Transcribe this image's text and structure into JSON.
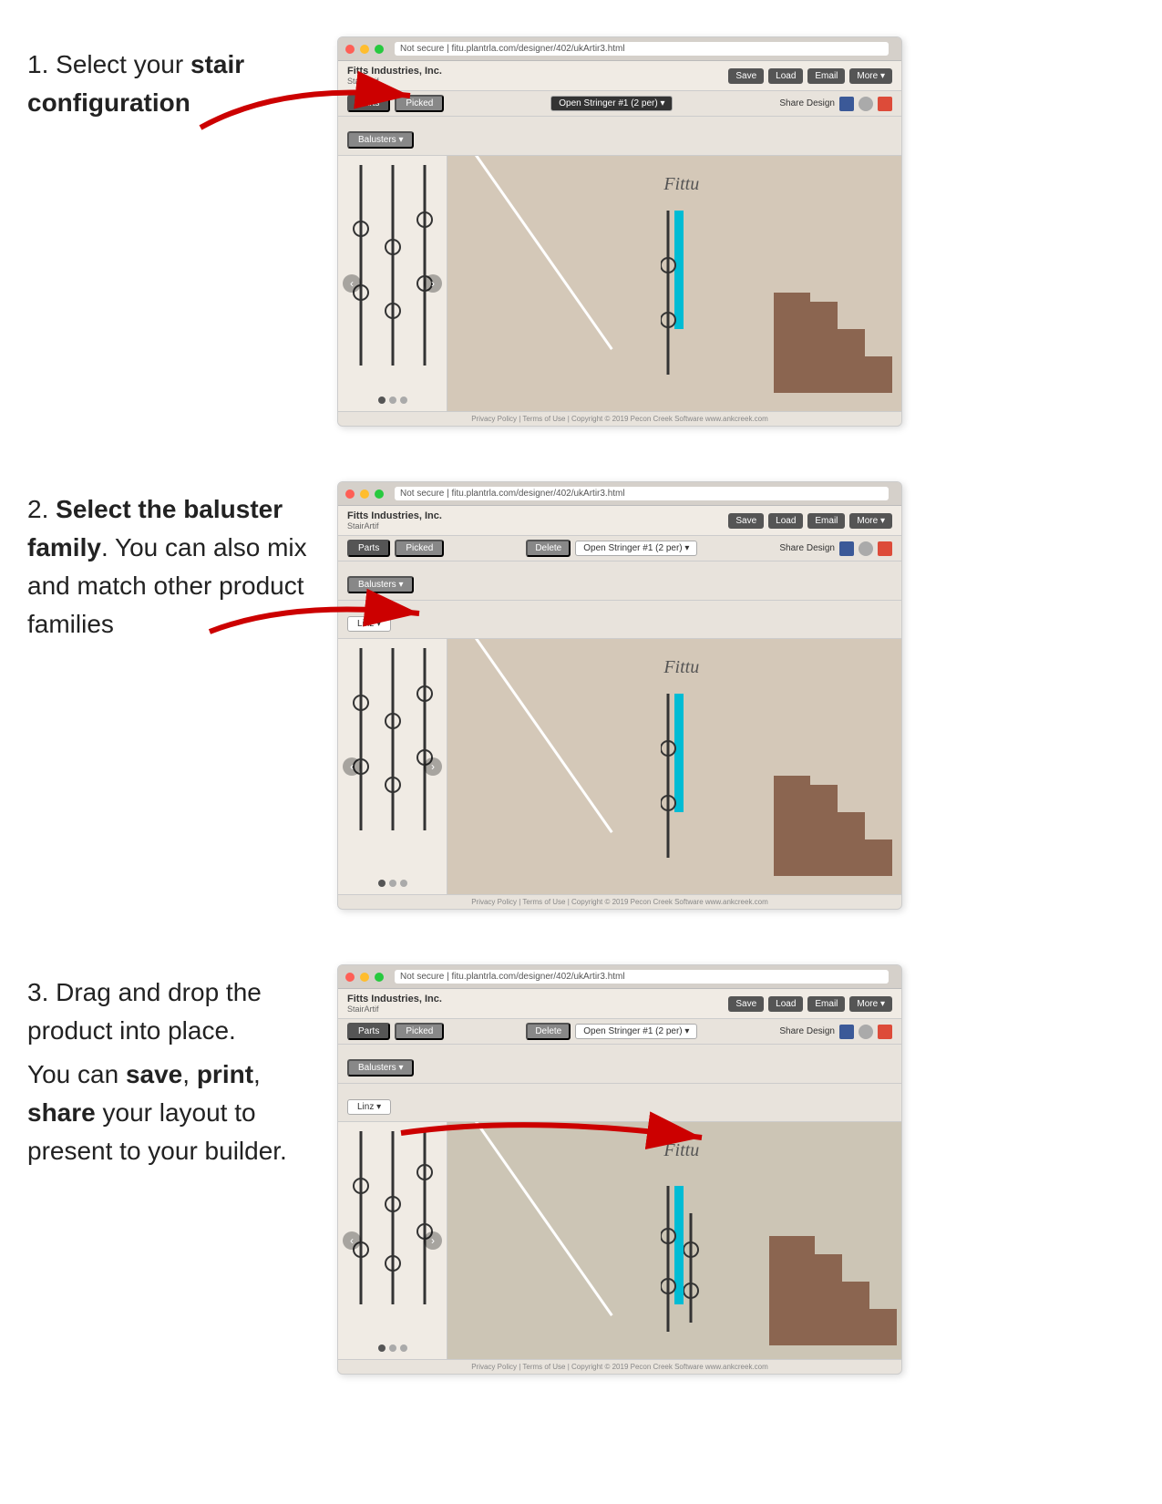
{
  "page": {
    "background": "#ffffff"
  },
  "steps": [
    {
      "number": "1.",
      "text_before": "Select your ",
      "bold_text": "stair configuration",
      "text_after": "",
      "show_delete": false,
      "show_linz": false
    },
    {
      "number": "2.",
      "text_line1_before": "",
      "text_line1_bold": "Select the baluster family",
      "text_line2": "You can also mix and match other product families",
      "show_delete": true,
      "show_linz": true
    },
    {
      "number": "3.",
      "lines": [
        {
          "before": "Drag and drop the product into place.",
          "bold": ""
        },
        {
          "before": "You can ",
          "bold": "save"
        },
        {
          "before": ", ",
          "bold": "print"
        },
        {
          "before": ", ",
          "bold": "share"
        },
        {
          "before": " your layout to present to your builder.",
          "bold": ""
        }
      ],
      "show_delete": true,
      "show_linz": true
    }
  ],
  "browser": {
    "url": "Not secure | fitu.plantrla.com/designer/402/ukArtir3.html",
    "logo": "Fitts Industries, Inc.",
    "logo_sub": "StairArtif",
    "btn_save": "Save",
    "btn_load": "Load",
    "btn_email": "Email",
    "btn_more": "More ▾",
    "tab_parts": "Parts",
    "tab_picked": "Picked",
    "dropdown_stringer": "Open Stringer #1 (2 per) ▾",
    "btn_delete": "Delete",
    "share_label": "Share Design",
    "section_balusters": "Balusters ▾",
    "family_linz": "Linz ▾",
    "footer_text": "Privacy Policy | Terms of Use | Copyright © 2019 Pecon Creek Software  www.ankcreek.com"
  }
}
